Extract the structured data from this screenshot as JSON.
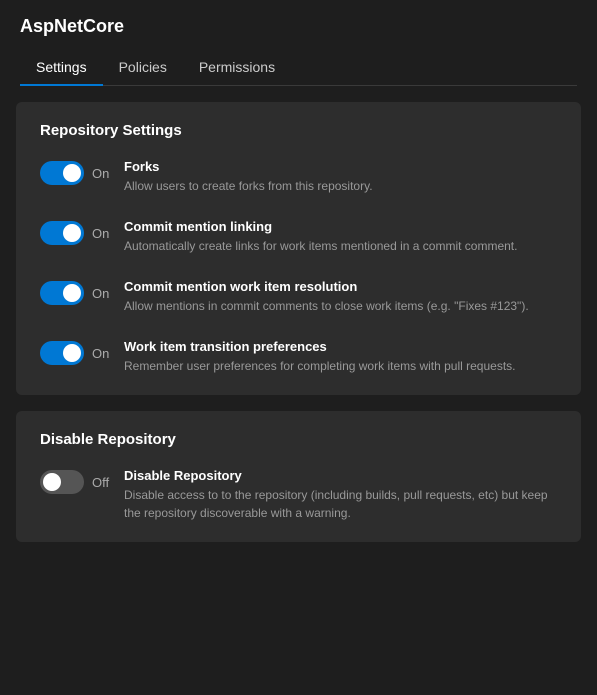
{
  "app": {
    "title": "AspNetCore"
  },
  "tabs": [
    {
      "id": "settings",
      "label": "Settings",
      "active": true
    },
    {
      "id": "policies",
      "label": "Policies",
      "active": false
    },
    {
      "id": "permissions",
      "label": "Permissions",
      "active": false
    }
  ],
  "sections": [
    {
      "id": "repository-settings",
      "title": "Repository Settings",
      "items": [
        {
          "id": "forks",
          "state": "on",
          "state_label": "On",
          "name": "Forks",
          "description": "Allow users to create forks from this repository."
        },
        {
          "id": "commit-mention-linking",
          "state": "on",
          "state_label": "On",
          "name": "Commit mention linking",
          "description": "Automatically create links for work items mentioned in a commit comment."
        },
        {
          "id": "commit-mention-resolution",
          "state": "on",
          "state_label": "On",
          "name": "Commit mention work item resolution",
          "description": "Allow mentions in commit comments to close work items (e.g. \"Fixes #123\")."
        },
        {
          "id": "work-item-transition",
          "state": "on",
          "state_label": "On",
          "name": "Work item transition preferences",
          "description": "Remember user preferences for completing work items with pull requests."
        }
      ]
    },
    {
      "id": "disable-repository",
      "title": "Disable Repository",
      "items": [
        {
          "id": "disable-repo",
          "state": "off",
          "state_label": "Off",
          "name": "Disable Repository",
          "description": "Disable access to to the repository (including builds, pull requests, etc) but keep the repository discoverable with a warning."
        }
      ]
    }
  ]
}
